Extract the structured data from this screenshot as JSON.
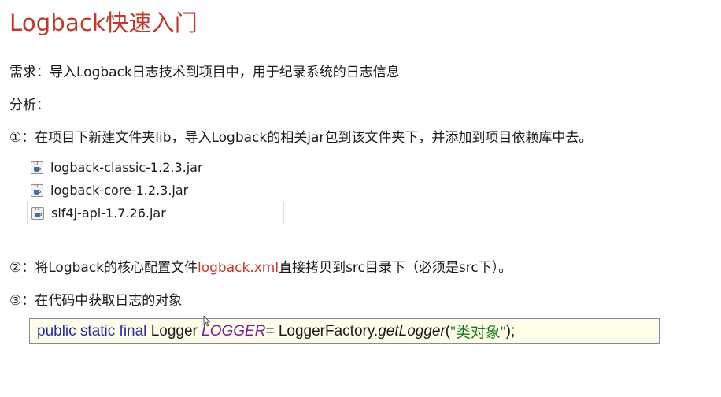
{
  "title": "Logback快速入门",
  "requirement": {
    "prefix": "需求：",
    "text": "导入Logback日志技术到项目中，用于纪录系统的日志信息"
  },
  "analysis_label": "分析：",
  "step1": {
    "marker": "①：",
    "text": "在项目下新建文件夹lib，导入Logback的相关jar包到该文件夹下，并添加到项目依赖库中去。"
  },
  "files": [
    {
      "name": "logback-classic-1.2.3.jar",
      "icon": "jar-file-icon"
    },
    {
      "name": "logback-core-1.2.3.jar",
      "icon": "jar-file-icon"
    },
    {
      "name": "slf4j-api-1.7.26.jar",
      "icon": "jar-file-icon"
    }
  ],
  "step2": {
    "marker": "②：",
    "before": "将Logback的核心配置文件",
    "highlight": "logback.xml",
    "after": "直接拷贝到src目录下（必须是src下）。"
  },
  "step3": {
    "marker": "③：",
    "text": "在代码中获取日志的对象"
  },
  "code": {
    "keywords": "public static final",
    "type": "Logger",
    "constant": "LOGGER",
    "assign": " = LoggerFactory.",
    "method": "getLogger",
    "open": "(",
    "string": "\"类对象\"",
    "close": ");"
  },
  "colors": {
    "title": "#c0392b",
    "highlight": "#c0392b",
    "keyword": "#2a2aa8",
    "constant": "#7a1f9e",
    "string": "#1b7a1b",
    "code_bg": "#fdfde9"
  }
}
